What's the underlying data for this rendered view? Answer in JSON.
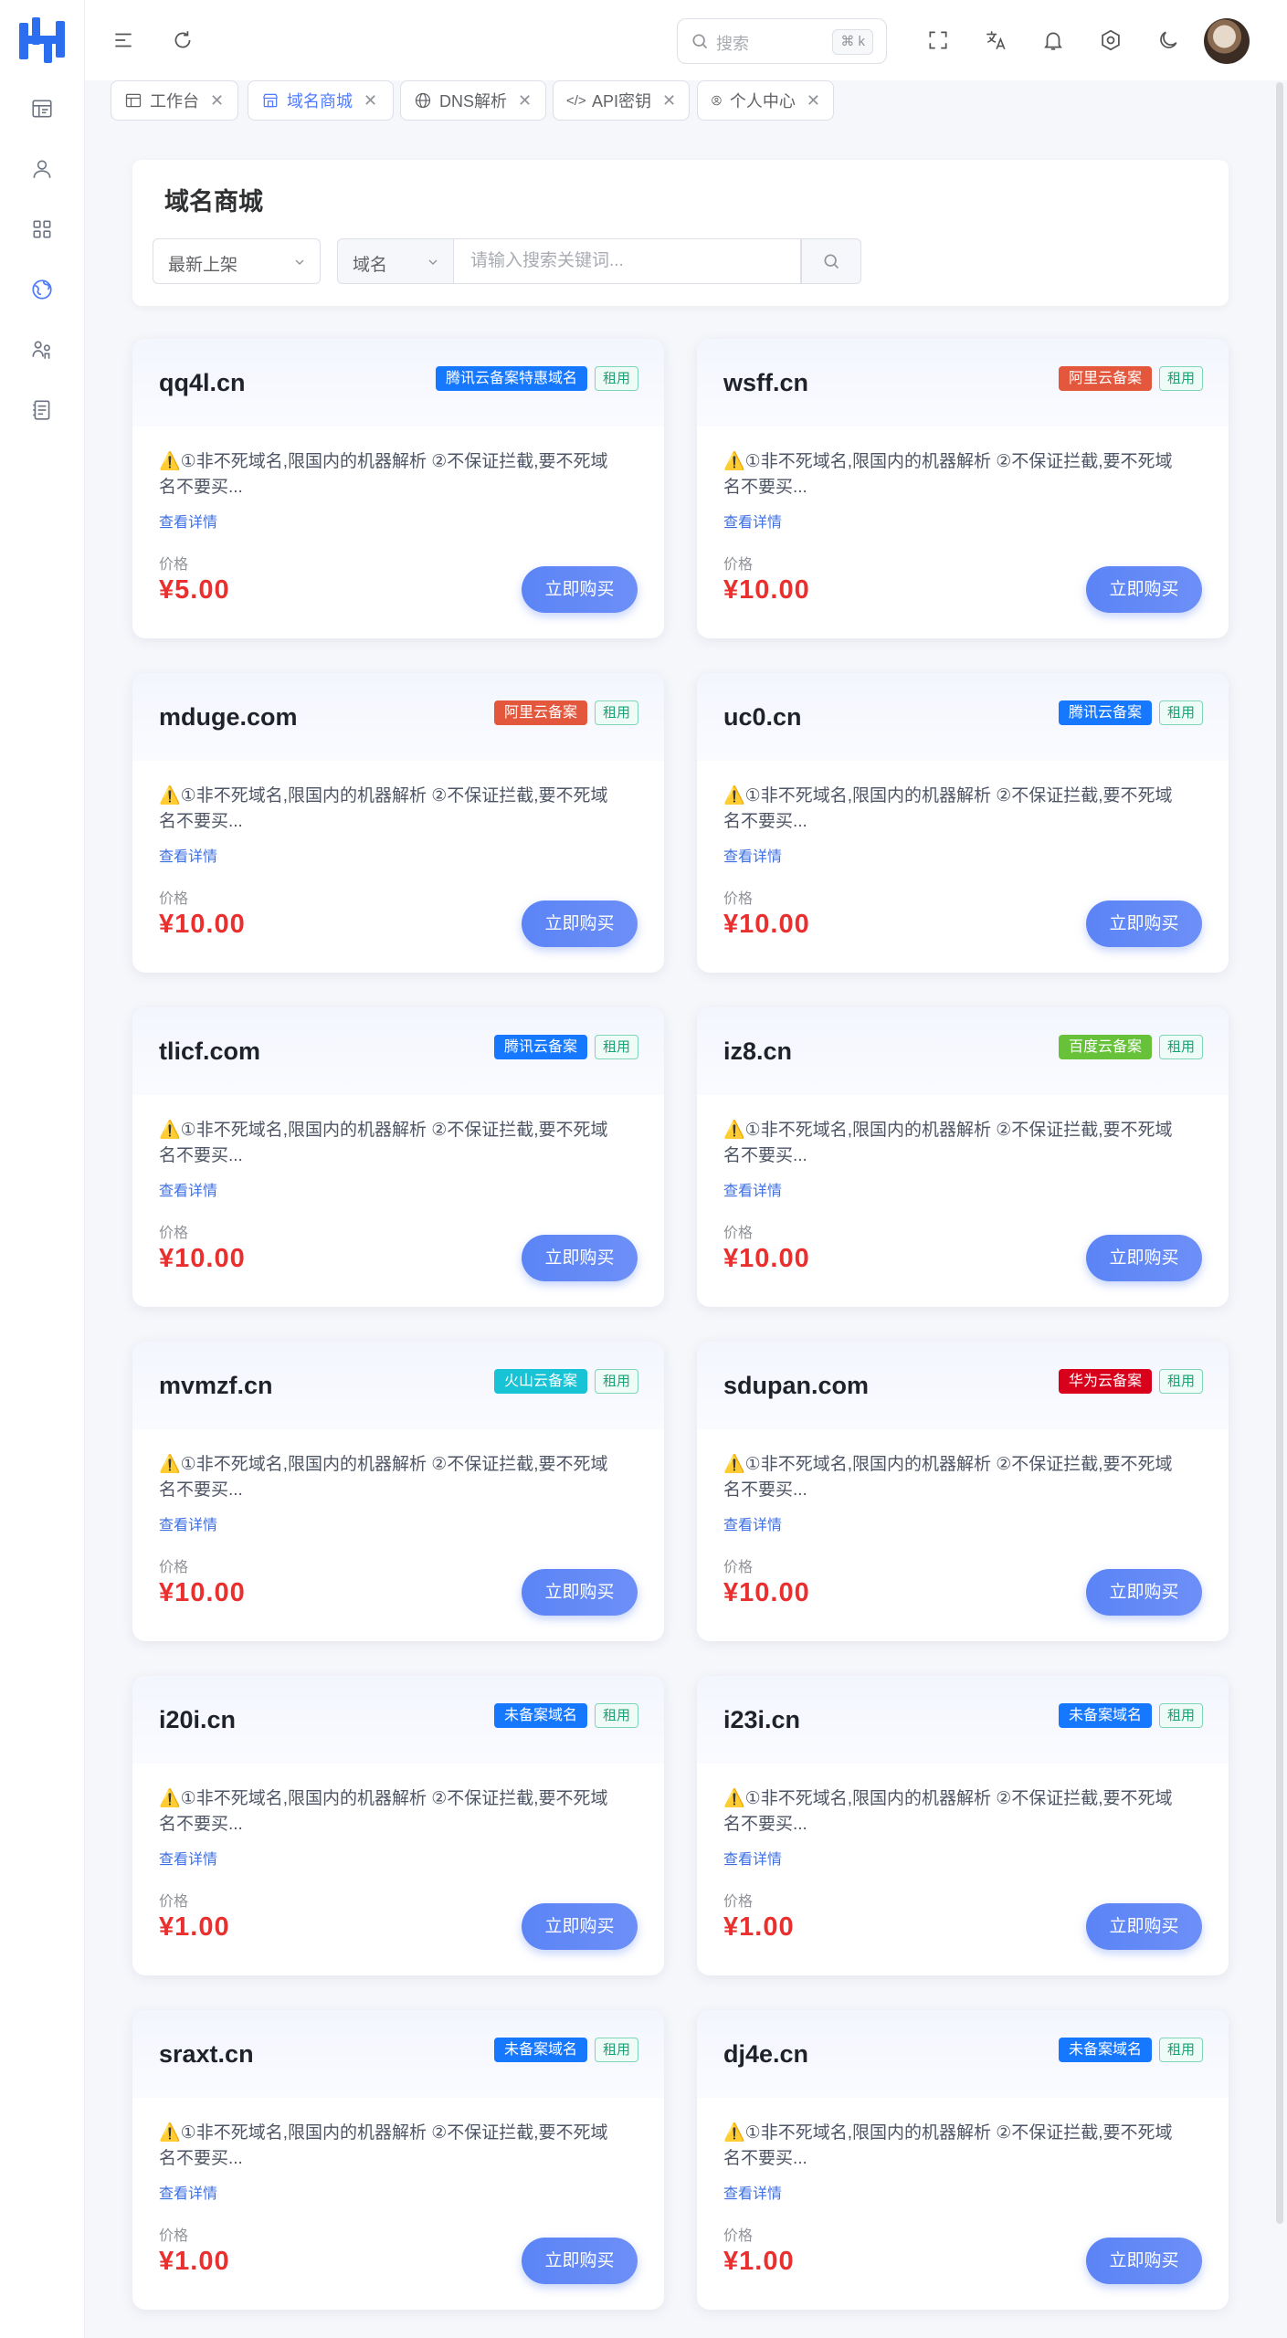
{
  "header": {
    "search_placeholder": "搜索",
    "search_shortcut": "⌘ k"
  },
  "tabs": [
    {
      "label": "工作台",
      "icon": "dashboard-icon",
      "active": false
    },
    {
      "label": "域名商城",
      "icon": "store-icon",
      "active": true
    },
    {
      "label": "DNS解析",
      "icon": "globe-icon",
      "active": false
    },
    {
      "label": "API密钥",
      "icon": "code-icon",
      "active": false
    },
    {
      "label": "个人中心",
      "icon": "user-circle-icon",
      "active": false
    }
  ],
  "page": {
    "title": "域名商城",
    "sort_select": "最新上架",
    "type_select": "域名",
    "keyword_placeholder": "请输入搜索关键词..."
  },
  "colors": {
    "accent": "#4f7cff",
    "price": "#ea2f2f",
    "tencent": "#1677ff",
    "aliyun": "#e3573d",
    "baidu": "#67c23a",
    "volcano": "#18c3d6",
    "huawei": "#d9001b",
    "unfiled": "#1677ff"
  },
  "card_labels": {
    "rent": "租用",
    "detail": "查看详情",
    "price_label": "价格",
    "buy": "立即购买"
  },
  "listings": [
    {
      "domain": "qq4l.cn",
      "tag": "腾讯云备案特惠域名",
      "tag_color": "#1677ff",
      "desc": "⚠️①非不死域名,限国内的机器解析 ②不保证拦截,要不死域名不要买...",
      "price": "¥5.00"
    },
    {
      "domain": "wsff.cn",
      "tag": "阿里云备案",
      "tag_color": "#e3573d",
      "desc": "⚠️①非不死域名,限国内的机器解析 ②不保证拦截,要不死域名不要买...",
      "price": "¥10.00"
    },
    {
      "domain": "mduge.com",
      "tag": "阿里云备案",
      "tag_color": "#e3573d",
      "desc": "⚠️①非不死域名,限国内的机器解析 ②不保证拦截,要不死域名不要买...",
      "price": "¥10.00"
    },
    {
      "domain": "uc0.cn",
      "tag": "腾讯云备案",
      "tag_color": "#1677ff",
      "desc": "⚠️①非不死域名,限国内的机器解析 ②不保证拦截,要不死域名不要买...",
      "price": "¥10.00"
    },
    {
      "domain": "tlicf.com",
      "tag": "腾讯云备案",
      "tag_color": "#1677ff",
      "desc": "⚠️①非不死域名,限国内的机器解析 ②不保证拦截,要不死域名不要买...",
      "price": "¥10.00"
    },
    {
      "domain": "iz8.cn",
      "tag": "百度云备案",
      "tag_color": "#67c23a",
      "desc": "⚠️①非不死域名,限国内的机器解析 ②不保证拦截,要不死域名不要买...",
      "price": "¥10.00"
    },
    {
      "domain": "mvmzf.cn",
      "tag": "火山云备案",
      "tag_color": "#18c3d6",
      "desc": "⚠️①非不死域名,限国内的机器解析 ②不保证拦截,要不死域名不要买...",
      "price": "¥10.00"
    },
    {
      "domain": "sdupan.com",
      "tag": "华为云备案",
      "tag_color": "#d9001b",
      "desc": "⚠️①非不死域名,限国内的机器解析 ②不保证拦截,要不死域名不要买...",
      "price": "¥10.00"
    },
    {
      "domain": "i20i.cn",
      "tag": "未备案域名",
      "tag_color": "#1677ff",
      "desc": "⚠️①非不死域名,限国内的机器解析 ②不保证拦截,要不死域名不要买...",
      "price": "¥1.00"
    },
    {
      "domain": "i23i.cn",
      "tag": "未备案域名",
      "tag_color": "#1677ff",
      "desc": "⚠️①非不死域名,限国内的机器解析 ②不保证拦截,要不死域名不要买...",
      "price": "¥1.00"
    },
    {
      "domain": "sraxt.cn",
      "tag": "未备案域名",
      "tag_color": "#1677ff",
      "desc": "⚠️①非不死域名,限国内的机器解析 ②不保证拦截,要不死域名不要买...",
      "price": "¥1.00"
    },
    {
      "domain": "dj4e.cn",
      "tag": "未备案域名",
      "tag_color": "#1677ff",
      "desc": "⚠️①非不死域名,限国内的机器解析 ②不保证拦截,要不死域名不要买...",
      "price": "¥1.00"
    }
  ]
}
